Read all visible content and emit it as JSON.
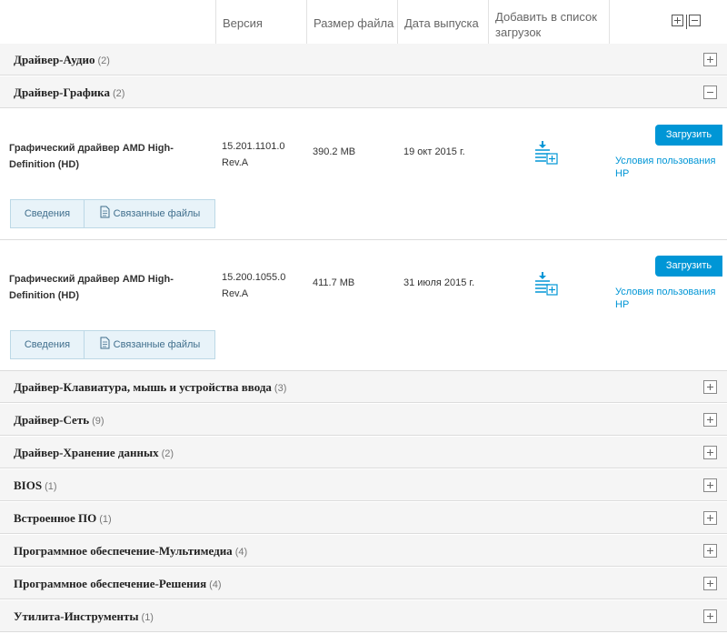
{
  "header": {
    "version": "Версия",
    "size": "Размер файла",
    "date": "Дата выпуска",
    "add": "Добавить в список загрузок"
  },
  "categories": [
    {
      "name": "Драйвер-Аудио",
      "count": "(2)"
    },
    {
      "name": "Драйвер-Графика",
      "count": "(2)"
    },
    {
      "name": "Драйвер-Клавиатура, мышь и устройства ввода",
      "count": "(3)"
    },
    {
      "name": "Драйвер-Сеть",
      "count": "(9)"
    },
    {
      "name": "Драйвер-Хранение данных",
      "count": "(2)"
    },
    {
      "name": "BIOS",
      "count": "(1)"
    },
    {
      "name": "Встроенное ПО",
      "count": "(1)"
    },
    {
      "name": "Программное обеспечение-Мультимедиа",
      "count": "(4)"
    },
    {
      "name": "Программное обеспечение-Решения",
      "count": "(4)"
    },
    {
      "name": "Утилита-Инструменты",
      "count": "(1)"
    }
  ],
  "items": [
    {
      "title": "Графический драйвер AMD High-Definition (HD)",
      "version_line1": "15.201.1101.0",
      "version_line2": "Rev.A",
      "size": "390.2 MB",
      "date": "19 окт 2015 г.",
      "download_label": "Загрузить",
      "terms_label": "Условия пользования HP",
      "details_tab": "Сведения",
      "related_tab": "Связанные файлы"
    },
    {
      "title": "Графический драйвер AMD High-Definition (HD)",
      "version_line1": "15.200.1055.0",
      "version_line2": "Rev.A",
      "size": "411.7 MB",
      "date": "31 июля 2015 г.",
      "download_label": "Загрузить",
      "terms_label": "Условия пользования HP",
      "details_tab": "Сведения",
      "related_tab": "Связанные файлы"
    }
  ]
}
